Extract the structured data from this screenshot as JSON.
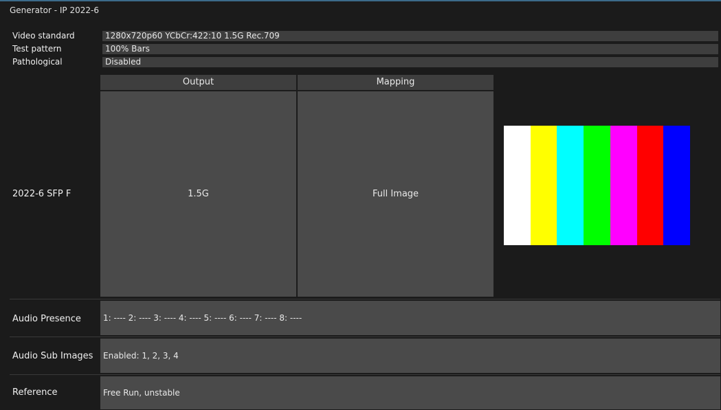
{
  "title": "Generator - IP 2022-6",
  "info": [
    {
      "label": "Video standard",
      "value": "1280x720p60 YCbCr:422:10 1.5G Rec.709"
    },
    {
      "label": "Test pattern",
      "value": "100% Bars"
    },
    {
      "label": "Pathological",
      "value": "Disabled"
    }
  ],
  "table": {
    "headers": {
      "output": "Output",
      "mapping": "Mapping"
    },
    "row_label": "2022-6 SFP F",
    "output_value": "1.5G",
    "mapping_value": "Full Image"
  },
  "color_bars": [
    "#ffffff",
    "#ffff00",
    "#00ffff",
    "#00ff00",
    "#ff00ff",
    "#ff0000",
    "#0000ff"
  ],
  "audio_presence": {
    "label": "Audio Presence",
    "value": "1: ---- 2: ---- 3: ---- 4: ---- 5: ---- 6: ---- 7: ---- 8: ----"
  },
  "audio_sub_images": {
    "label": "Audio Sub Images",
    "value": "Enabled: 1, 2, 3, 4"
  },
  "reference": {
    "label": "Reference",
    "value": "Free Run, unstable"
  }
}
